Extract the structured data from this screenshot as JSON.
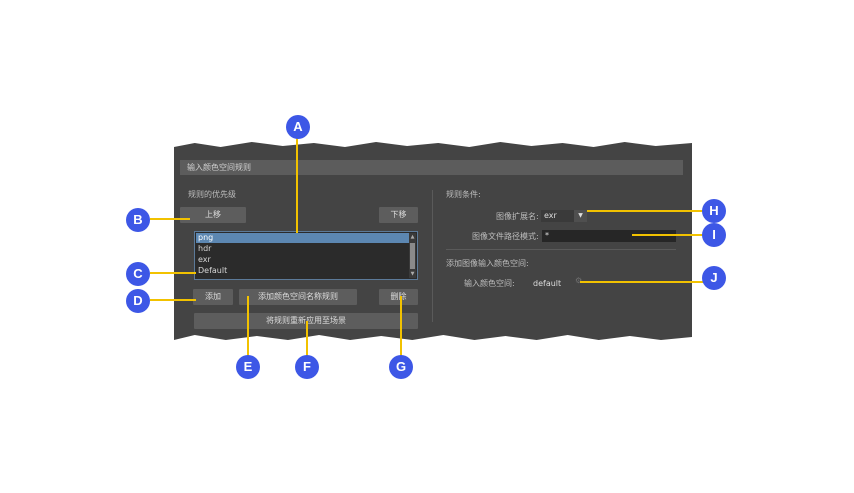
{
  "panel": {
    "section_title": "输入颜色空间规则",
    "left": {
      "priority_label": "规则的优先级",
      "move_up_label": "上移",
      "move_down_label": "下移",
      "list_items": [
        "png",
        "hdr",
        "exr",
        "Default"
      ],
      "selected_item": "png",
      "add_label": "添加",
      "add_name_rule_label": "添加颜色空间名称规则",
      "delete_label": "删除",
      "reapply_label": "将规则重新应用至场景"
    },
    "right": {
      "conditions_label": "规则条件:",
      "extension_label": "图像扩展名:",
      "extension_value": "exr",
      "path_pattern_label": "图像文件路径模式:",
      "path_pattern_value": "*",
      "add_input_space_label": "添加图像输入颜色空间:",
      "input_space_label": "输入颜色空间:",
      "input_space_value": "default"
    }
  },
  "callouts": [
    "A",
    "B",
    "C",
    "D",
    "E",
    "F",
    "G",
    "H",
    "I",
    "J"
  ],
  "icons": {
    "dropdown": "triangle-down-icon",
    "gear": "gear-icon",
    "scroll_up": "scroll-up-icon",
    "scroll_down": "scroll-down-icon"
  },
  "colors": {
    "panel_bg": "#444444",
    "selection": "#5c87b2",
    "callout_line": "#f2c200",
    "callout_badge": "#3d57e6"
  }
}
